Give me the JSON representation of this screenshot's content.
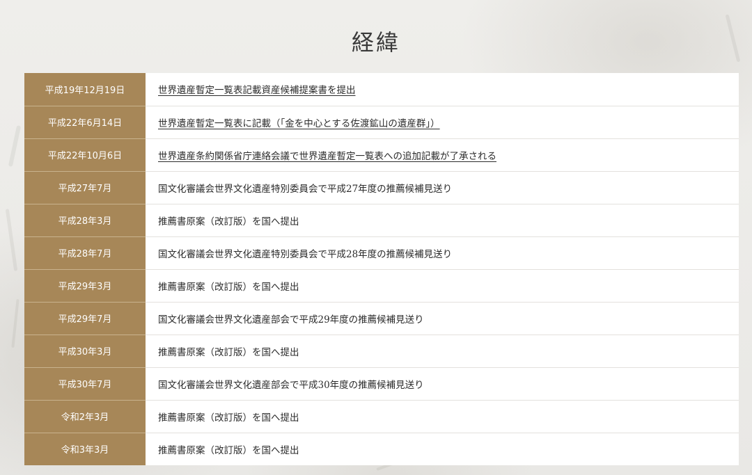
{
  "page": {
    "title": "経緯"
  },
  "colors": {
    "date_cell_bg": "#a78758",
    "event_cell_bg": "#ffffff",
    "text": "#2b2b2b"
  },
  "timeline": [
    {
      "date": "平成19年12月19日",
      "event": "世界遺産暫定一覧表記載資産候補提案書を提出",
      "link": true
    },
    {
      "date": "平成22年6月14日",
      "event": "世界遺産暫定一覧表に記載（「金を中心とする佐渡鉱山の遺産群」）",
      "link": true
    },
    {
      "date": "平成22年10月6日",
      "event": "世界遺産条約関係省庁連絡会議で世界遺産暫定一覧表への追加記載が了承される",
      "link": true
    },
    {
      "date": "平成27年7月",
      "event": "国文化審議会世界文化遺産特別委員会で平成27年度の推薦候補見送り",
      "link": false
    },
    {
      "date": "平成28年3月",
      "event": "推薦書原案（改訂版）を国へ提出",
      "link": false
    },
    {
      "date": "平成28年7月",
      "event": "国文化審議会世界文化遺産特別委員会で平成28年度の推薦候補見送り",
      "link": false
    },
    {
      "date": "平成29年3月",
      "event": "推薦書原案（改訂版）を国へ提出",
      "link": false
    },
    {
      "date": "平成29年7月",
      "event": "国文化審議会世界文化遺産部会で平成29年度の推薦候補見送り",
      "link": false
    },
    {
      "date": "平成30年3月",
      "event": "推薦書原案（改訂版）を国へ提出",
      "link": false
    },
    {
      "date": "平成30年7月",
      "event": "国文化審議会世界文化遺産部会で平成30年度の推薦候補見送り",
      "link": false
    },
    {
      "date": "令和2年3月",
      "event": "推薦書原案（改訂版）を国へ提出",
      "link": false
    },
    {
      "date": "令和3年3月",
      "event": "推薦書原案（改訂版）を国へ提出",
      "link": false
    }
  ]
}
